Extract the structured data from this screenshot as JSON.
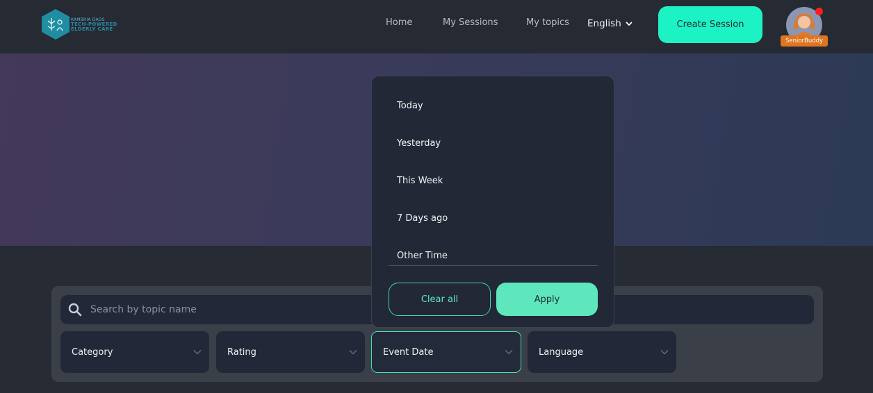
{
  "header": {
    "logo": {
      "line1": "KAMBRIA DAOS",
      "line2": "TECH-POWERED",
      "line3": "ELDERLY CARE"
    },
    "nav": [
      {
        "label": "Home"
      },
      {
        "label": "My Sessions"
      },
      {
        "label": "My topics"
      }
    ],
    "language": "English",
    "create_button": "Create Session",
    "user_badge": "SeniorBuddy"
  },
  "search": {
    "placeholder": "Search by topic name"
  },
  "filters": [
    {
      "label": "Category"
    },
    {
      "label": "Rating"
    },
    {
      "label": "Event Date"
    },
    {
      "label": "Language"
    }
  ],
  "date_dropdown": {
    "options": [
      "Today",
      "Yesterday",
      "This Week",
      "7 Days ago",
      "Other Time"
    ],
    "clear_label": "Clear all",
    "apply_label": "Apply"
  },
  "colors": {
    "accent": "#1df2c4",
    "apply": "#5ee6bd",
    "badge": "#e0741f",
    "notification": "#ff1c1c"
  }
}
